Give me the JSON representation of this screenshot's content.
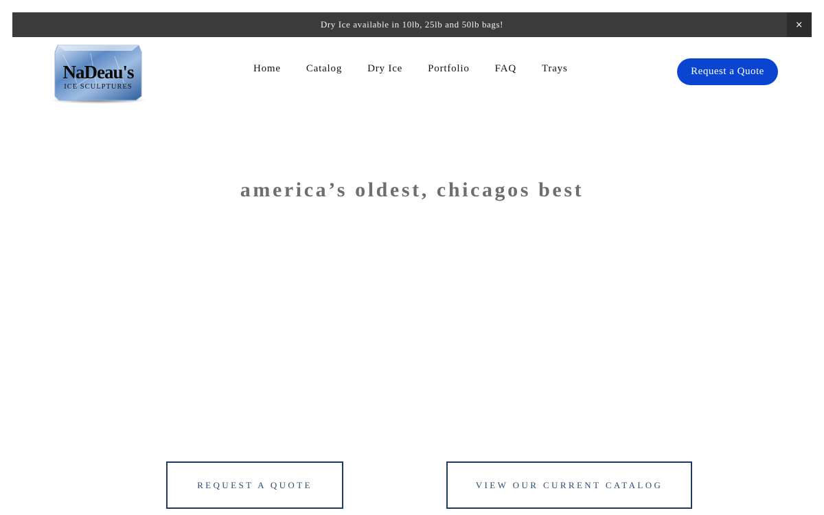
{
  "announcement": {
    "text": "Dry Ice available in 10lb, 25lb and 50lb bags!",
    "close_label": "×"
  },
  "logo": {
    "line1": "NaDeau's",
    "line2": "ICE SCULPTURES",
    "ice_color": "#3f6fae"
  },
  "nav": {
    "items": [
      {
        "label": "Home"
      },
      {
        "label": "Catalog"
      },
      {
        "label": "Dry Ice"
      },
      {
        "label": "Portfolio"
      },
      {
        "label": "FAQ"
      },
      {
        "label": "Trays"
      }
    ],
    "cta_label": "Request a Quote",
    "cta_color": "#0a45d1"
  },
  "hero": {
    "title": "america’s oldest, chicagos best"
  },
  "actions": {
    "primary_label": "REQUEST A QUOTE",
    "secondary_label": "VIEW OUR CURRENT CATALOG",
    "border_color": "#1f3a5f"
  }
}
